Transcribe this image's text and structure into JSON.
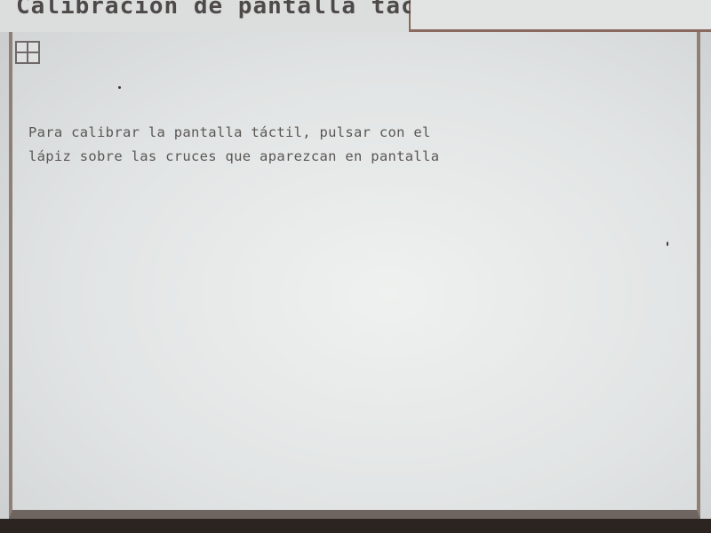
{
  "window": {
    "title": "Calibración de pantalla táctil"
  },
  "toolbar": {
    "grid_icon": "grid-icon"
  },
  "content": {
    "instructions": "Para calibrar la pantalla táctil, pulsar con el lápiz sobre las cruces que aparezcan en pantalla"
  },
  "colors": {
    "border": "#8a6a60",
    "text": "#5b5656",
    "background": "#e1e4e4"
  }
}
